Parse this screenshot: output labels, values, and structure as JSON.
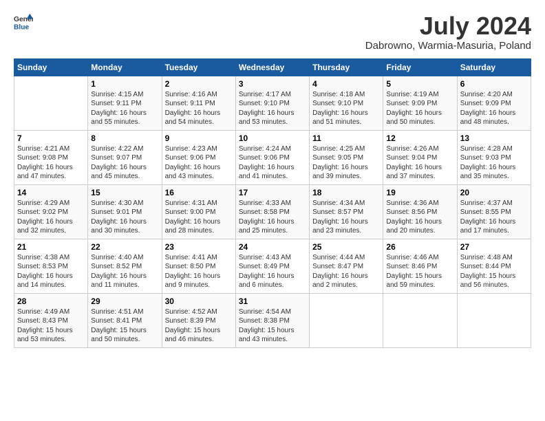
{
  "header": {
    "logo_general": "General",
    "logo_blue": "Blue",
    "month_title": "July 2024",
    "location": "Dabrowno, Warmia-Masuria, Poland"
  },
  "weekdays": [
    "Sunday",
    "Monday",
    "Tuesday",
    "Wednesday",
    "Thursday",
    "Friday",
    "Saturday"
  ],
  "weeks": [
    [
      {
        "day": "",
        "sunrise": "",
        "sunset": "",
        "daylight": ""
      },
      {
        "day": "1",
        "sunrise": "4:15 AM",
        "sunset": "9:11 PM",
        "daylight": "16 hours and 55 minutes."
      },
      {
        "day": "2",
        "sunrise": "4:16 AM",
        "sunset": "9:11 PM",
        "daylight": "16 hours and 54 minutes."
      },
      {
        "day": "3",
        "sunrise": "4:17 AM",
        "sunset": "9:10 PM",
        "daylight": "16 hours and 53 minutes."
      },
      {
        "day": "4",
        "sunrise": "4:18 AM",
        "sunset": "9:10 PM",
        "daylight": "16 hours and 51 minutes."
      },
      {
        "day": "5",
        "sunrise": "4:19 AM",
        "sunset": "9:09 PM",
        "daylight": "16 hours and 50 minutes."
      },
      {
        "day": "6",
        "sunrise": "4:20 AM",
        "sunset": "9:09 PM",
        "daylight": "16 hours and 48 minutes."
      }
    ],
    [
      {
        "day": "7",
        "sunrise": "4:21 AM",
        "sunset": "9:08 PM",
        "daylight": "16 hours and 47 minutes."
      },
      {
        "day": "8",
        "sunrise": "4:22 AM",
        "sunset": "9:07 PM",
        "daylight": "16 hours and 45 minutes."
      },
      {
        "day": "9",
        "sunrise": "4:23 AM",
        "sunset": "9:06 PM",
        "daylight": "16 hours and 43 minutes."
      },
      {
        "day": "10",
        "sunrise": "4:24 AM",
        "sunset": "9:06 PM",
        "daylight": "16 hours and 41 minutes."
      },
      {
        "day": "11",
        "sunrise": "4:25 AM",
        "sunset": "9:05 PM",
        "daylight": "16 hours and 39 minutes."
      },
      {
        "day": "12",
        "sunrise": "4:26 AM",
        "sunset": "9:04 PM",
        "daylight": "16 hours and 37 minutes."
      },
      {
        "day": "13",
        "sunrise": "4:28 AM",
        "sunset": "9:03 PM",
        "daylight": "16 hours and 35 minutes."
      }
    ],
    [
      {
        "day": "14",
        "sunrise": "4:29 AM",
        "sunset": "9:02 PM",
        "daylight": "16 hours and 32 minutes."
      },
      {
        "day": "15",
        "sunrise": "4:30 AM",
        "sunset": "9:01 PM",
        "daylight": "16 hours and 30 minutes."
      },
      {
        "day": "16",
        "sunrise": "4:31 AM",
        "sunset": "9:00 PM",
        "daylight": "16 hours and 28 minutes."
      },
      {
        "day": "17",
        "sunrise": "4:33 AM",
        "sunset": "8:58 PM",
        "daylight": "16 hours and 25 minutes."
      },
      {
        "day": "18",
        "sunrise": "4:34 AM",
        "sunset": "8:57 PM",
        "daylight": "16 hours and 23 minutes."
      },
      {
        "day": "19",
        "sunrise": "4:36 AM",
        "sunset": "8:56 PM",
        "daylight": "16 hours and 20 minutes."
      },
      {
        "day": "20",
        "sunrise": "4:37 AM",
        "sunset": "8:55 PM",
        "daylight": "16 hours and 17 minutes."
      }
    ],
    [
      {
        "day": "21",
        "sunrise": "4:38 AM",
        "sunset": "8:53 PM",
        "daylight": "16 hours and 14 minutes."
      },
      {
        "day": "22",
        "sunrise": "4:40 AM",
        "sunset": "8:52 PM",
        "daylight": "16 hours and 11 minutes."
      },
      {
        "day": "23",
        "sunrise": "4:41 AM",
        "sunset": "8:50 PM",
        "daylight": "16 hours and 9 minutes."
      },
      {
        "day": "24",
        "sunrise": "4:43 AM",
        "sunset": "8:49 PM",
        "daylight": "16 hours and 6 minutes."
      },
      {
        "day": "25",
        "sunrise": "4:44 AM",
        "sunset": "8:47 PM",
        "daylight": "16 hours and 2 minutes."
      },
      {
        "day": "26",
        "sunrise": "4:46 AM",
        "sunset": "8:46 PM",
        "daylight": "15 hours and 59 minutes."
      },
      {
        "day": "27",
        "sunrise": "4:48 AM",
        "sunset": "8:44 PM",
        "daylight": "15 hours and 56 minutes."
      }
    ],
    [
      {
        "day": "28",
        "sunrise": "4:49 AM",
        "sunset": "8:43 PM",
        "daylight": "15 hours and 53 minutes."
      },
      {
        "day": "29",
        "sunrise": "4:51 AM",
        "sunset": "8:41 PM",
        "daylight": "15 hours and 50 minutes."
      },
      {
        "day": "30",
        "sunrise": "4:52 AM",
        "sunset": "8:39 PM",
        "daylight": "15 hours and 46 minutes."
      },
      {
        "day": "31",
        "sunrise": "4:54 AM",
        "sunset": "8:38 PM",
        "daylight": "15 hours and 43 minutes."
      },
      {
        "day": "",
        "sunrise": "",
        "sunset": "",
        "daylight": ""
      },
      {
        "day": "",
        "sunrise": "",
        "sunset": "",
        "daylight": ""
      },
      {
        "day": "",
        "sunrise": "",
        "sunset": "",
        "daylight": ""
      }
    ]
  ]
}
